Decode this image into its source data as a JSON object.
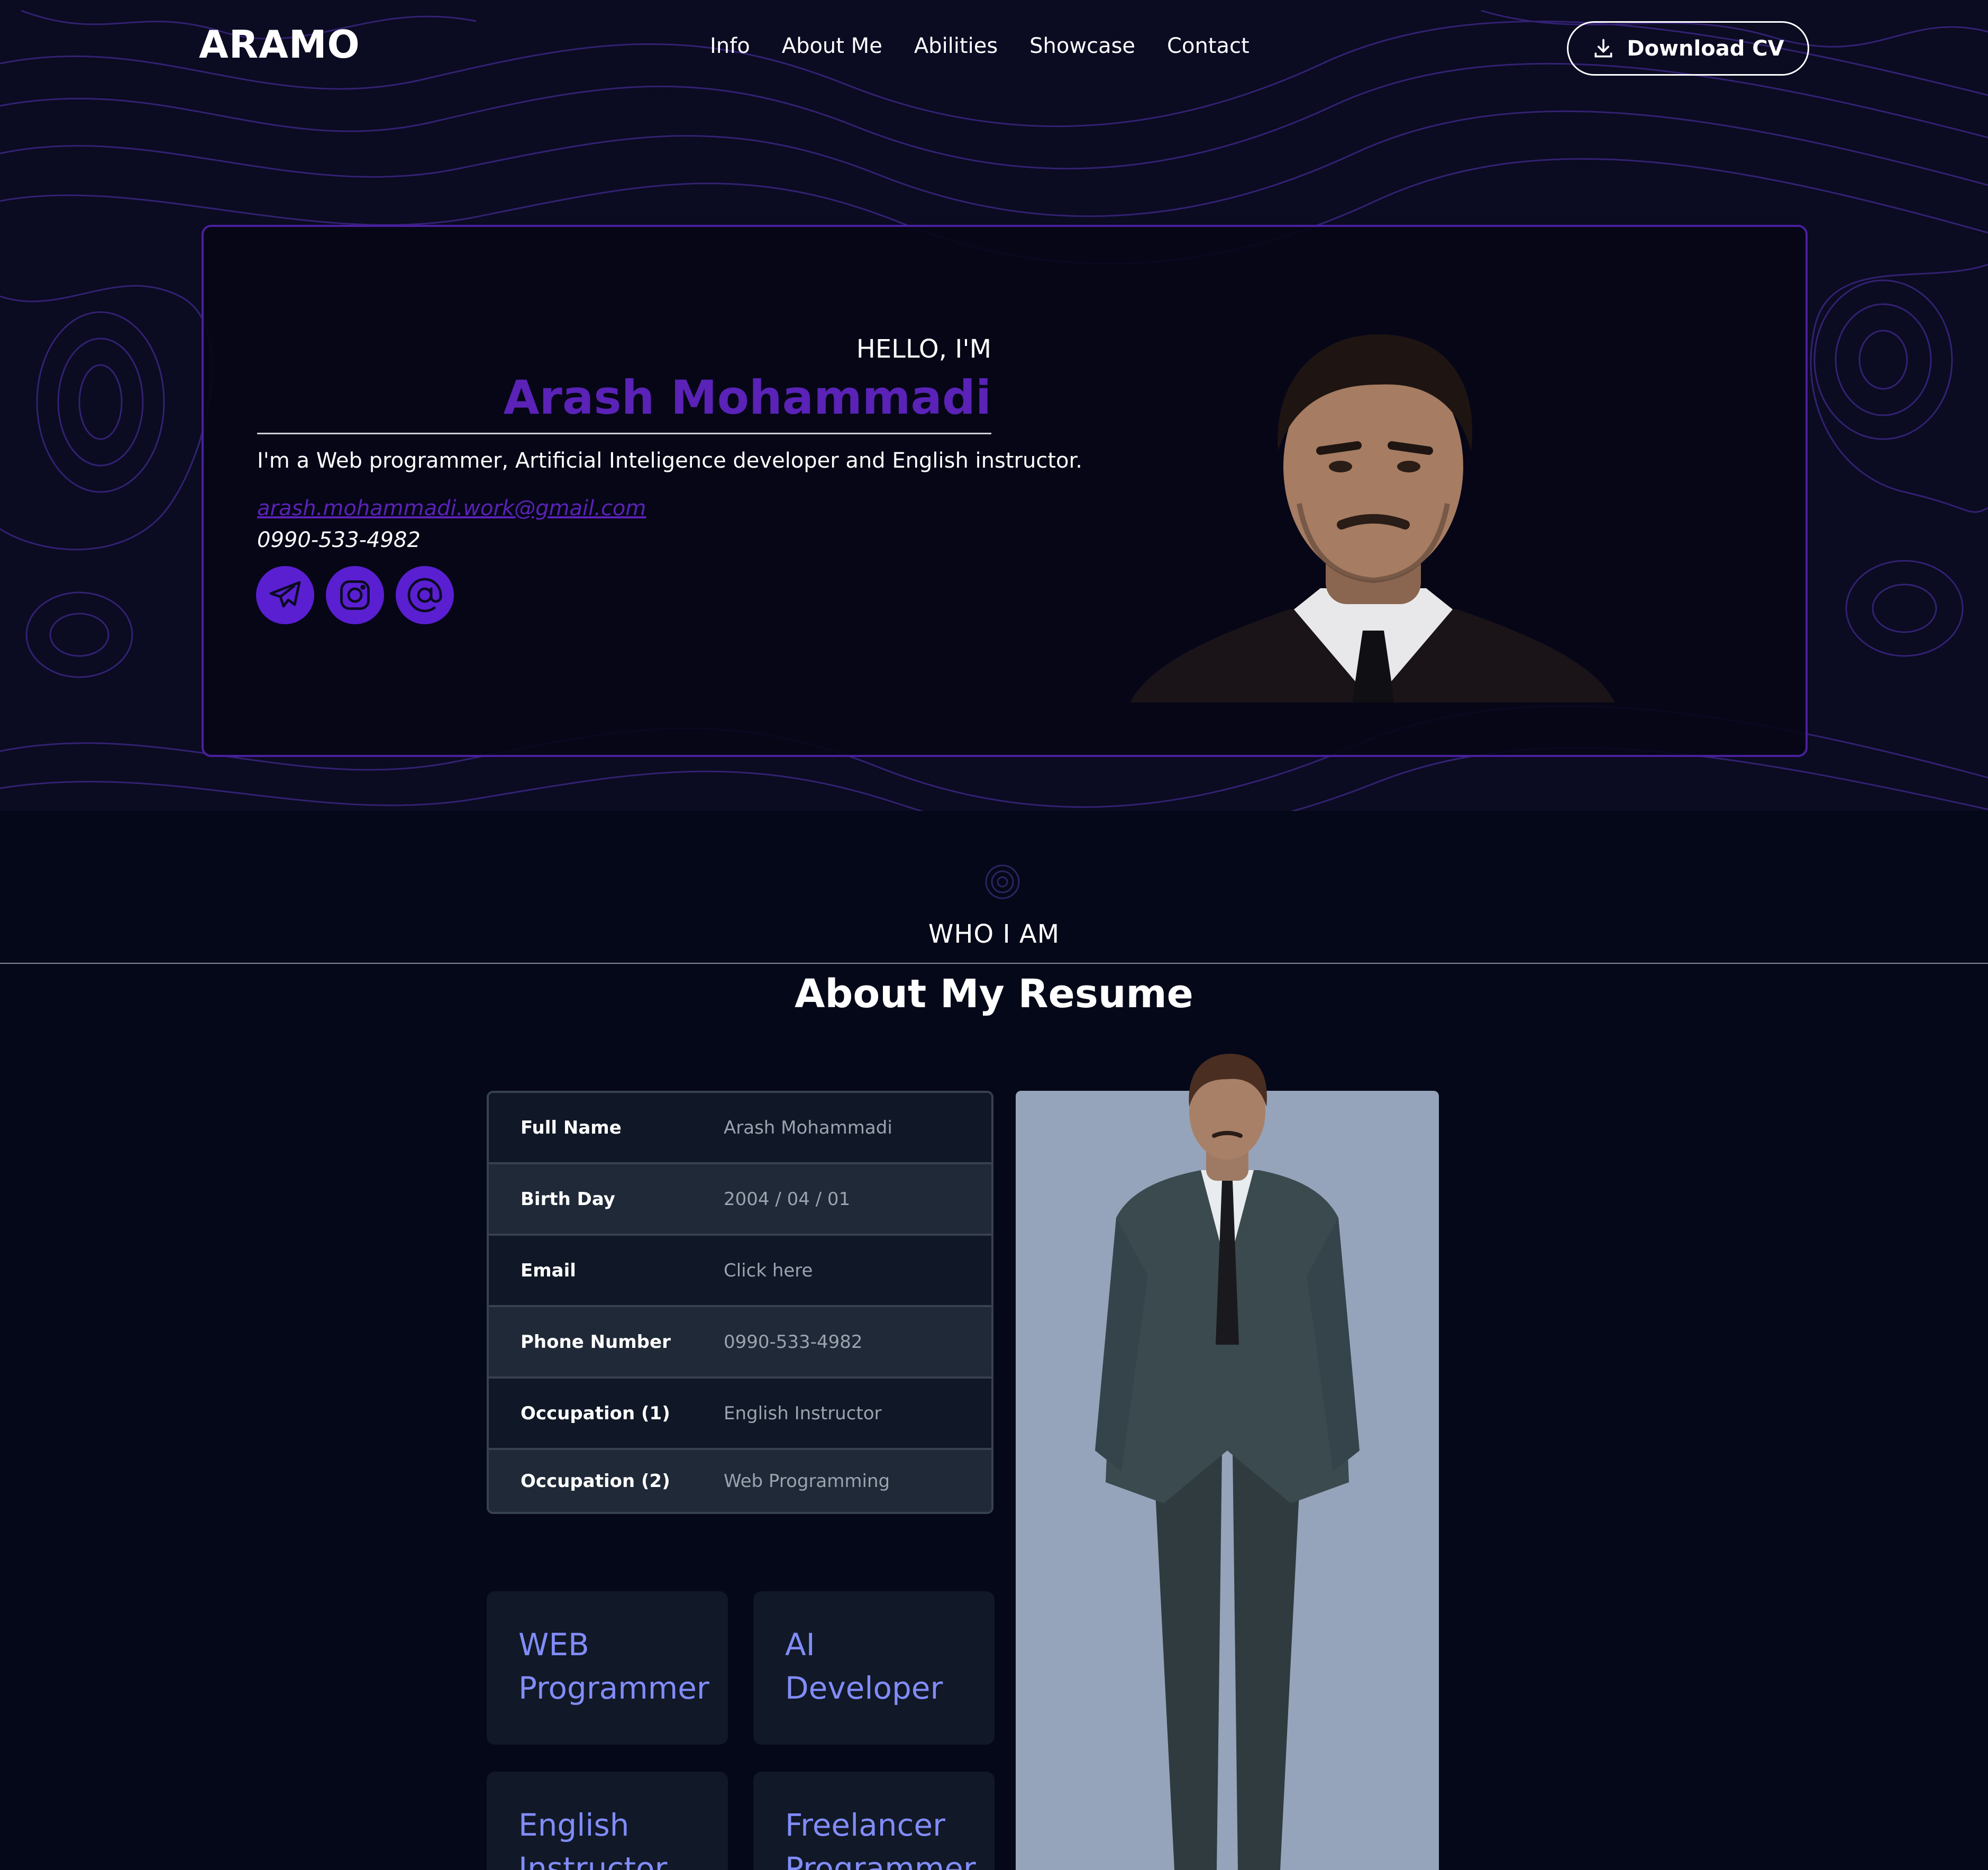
{
  "nav": {
    "logo": "ARAMO",
    "links": [
      "Info",
      "About Me",
      "Abilities",
      "Showcase",
      "Contact"
    ],
    "download_label": "Download CV",
    "download_icon": "download-icon"
  },
  "hero": {
    "greeting": "HELLO, I'M",
    "name": "Arash Mohammadi",
    "description": "I'm a Web programmer, Artificial Inteligence developer and English instructor.",
    "email": "arash.mohammadi.work@gmail.com",
    "phone": "0990-533-4982",
    "socials": [
      "telegram-icon",
      "instagram-icon",
      "at-sign-icon"
    ],
    "accent_color": "#5a22b6"
  },
  "about": {
    "section_label": "WHO I AM",
    "title": "About My Resume",
    "info_rows": [
      {
        "key": "Full Name",
        "value": "Arash Mohammadi"
      },
      {
        "key": "Birth Day",
        "value": "2004 / 04 / 01"
      },
      {
        "key": "Email",
        "value": "Click here"
      },
      {
        "key": "Phone Number",
        "value": "0990-533-4982"
      },
      {
        "key": "Occupation (1)",
        "value": "English Instructor"
      },
      {
        "key": "Occupation (2)",
        "value": "Web Programming"
      }
    ],
    "roles": [
      {
        "line1": "WEB",
        "line2": "Programmer"
      },
      {
        "line1": "AI",
        "line2": "Developer"
      },
      {
        "line1": "English",
        "line2": "Instructor"
      },
      {
        "line1": "Freelancer",
        "line2": "Programmer"
      }
    ]
  }
}
